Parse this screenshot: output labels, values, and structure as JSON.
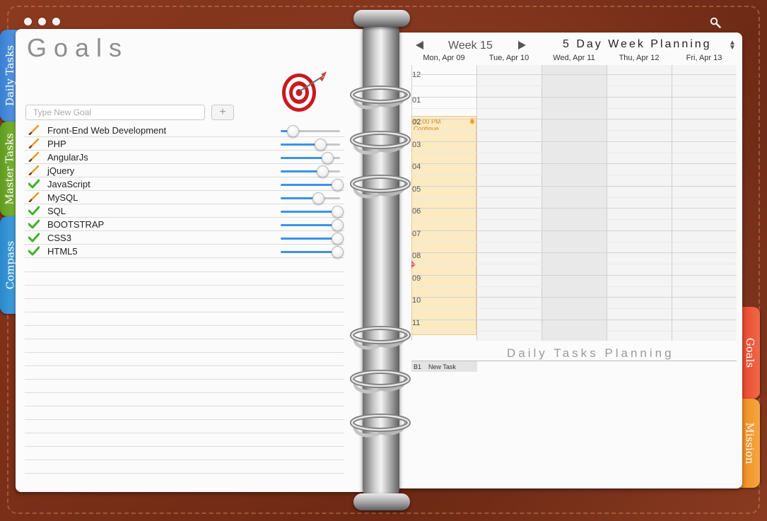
{
  "left_tabs": [
    {
      "label": "Daily Tasks"
    },
    {
      "label": "Master Tasks"
    },
    {
      "label": "Compass"
    }
  ],
  "right_tabs": [
    {
      "label": "Goals"
    },
    {
      "label": "Mission"
    }
  ],
  "goals_page": {
    "title": "Goals",
    "input_placeholder": "Type New Goal",
    "add_label": "+",
    "goals": [
      {
        "label": "Front-End Web Development",
        "status": "pencil",
        "progress": 0.2
      },
      {
        "label": "PHP",
        "status": "pencil",
        "progress": 0.67
      },
      {
        "label": "AngularJs",
        "status": "pencil",
        "progress": 0.78
      },
      {
        "label": "jQuery",
        "status": "pencil",
        "progress": 0.7
      },
      {
        "label": "JavaScript",
        "status": "check",
        "progress": 1.0
      },
      {
        "label": "MySQL",
        "status": "pencil",
        "progress": 0.63
      },
      {
        "label": "SQL",
        "status": "check",
        "progress": 1.0
      },
      {
        "label": "BOOTSTRAP",
        "status": "check",
        "progress": 1.0
      },
      {
        "label": "CSS3",
        "status": "check",
        "progress": 1.0
      },
      {
        "label": "HTML5",
        "status": "check",
        "progress": 1.0
      }
    ]
  },
  "planning_page": {
    "week_label": "Week 15",
    "title": "5 Day Week Planning",
    "days": [
      "Mon, Apr 09",
      "Tue, Apr 10",
      "Wed, Apr 11",
      "Thu, Apr 12",
      "Fri, Apr 13"
    ],
    "hours": [
      "12",
      "01",
      "02",
      "03",
      "04",
      "05",
      "06",
      "07",
      "08",
      "09",
      "10",
      "11"
    ],
    "event": {
      "time": "02:00 PM",
      "text": "Continue..."
    },
    "daily_tasks_title": "Daily Tasks Planning",
    "task": {
      "code": "B1",
      "name": "New Task"
    }
  },
  "colors": {
    "leather": "#7a301a",
    "slider_fill": "#3b93e8",
    "event_fill": "#fce2aa",
    "now_marker": "#e4505c"
  }
}
